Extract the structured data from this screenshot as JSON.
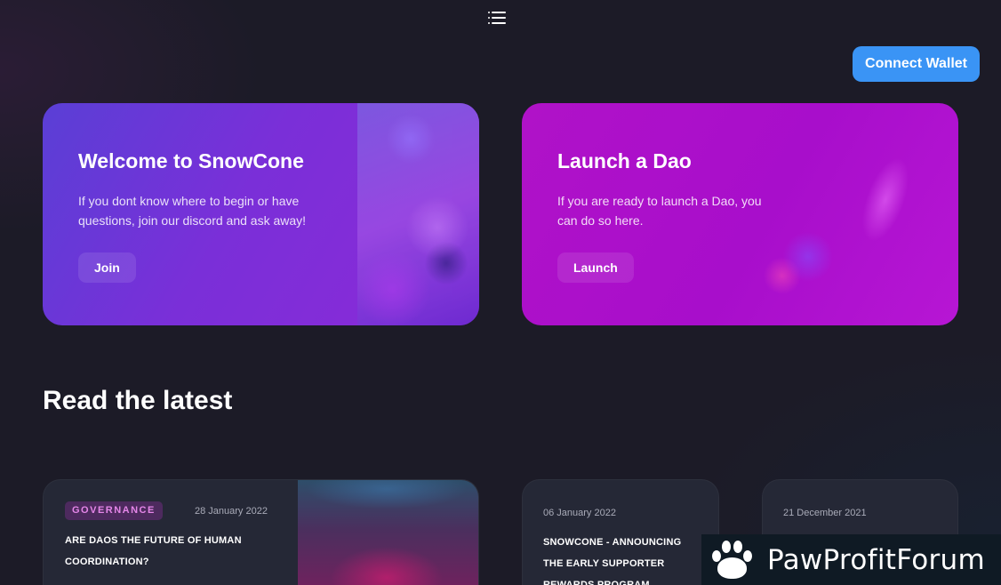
{
  "header": {
    "menu_icon": "hamburger-menu-icon",
    "connect_wallet_label": "Connect Wallet"
  },
  "hero_cards": [
    {
      "title": "Welcome to SnowCone",
      "description": "If you dont know where to begin or have questions, join our discord and ask away!",
      "button_label": "Join"
    },
    {
      "title": "Launch a Dao",
      "description": "If you are ready to launch a Dao, you can do so here.",
      "button_label": "Launch"
    }
  ],
  "latest": {
    "title": "Read the latest",
    "posts": [
      {
        "tag": "GOVERNANCE",
        "date": "28 January 2022",
        "title": "ARE DAOS THE FUTURE OF HUMAN COORDINATION?"
      },
      {
        "date": "06 January 2022",
        "title": "SNOWCONE - ANNOUNCING THE EARLY SUPPORTER REWARDS PROGRAM"
      },
      {
        "date": "21 December 2021",
        "title": ""
      }
    ]
  },
  "watermark": {
    "text": "PawProfitForum",
    "icon": "paw-icon"
  },
  "colors": {
    "background": "#1c1b27",
    "connect_button": "#3a94f5",
    "card_welcome": "#7a2fd8",
    "card_dao": "#a80ecb",
    "tag_text": "#e486e8",
    "tag_bg": "#4d2a5e"
  }
}
